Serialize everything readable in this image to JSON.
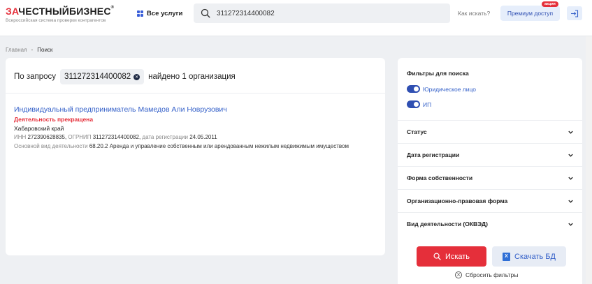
{
  "header": {
    "logo_red": "ЗА",
    "logo_dark": "ЧЕСТНЫЙБИЗНЕС",
    "logo_mark": "®",
    "logo_tagline": "Всероссийская система проверки контрагентов",
    "services_label": "Все услуги",
    "search_value": "311272314400082",
    "howto_label": "Как искать?",
    "premium_label": "Премиум доступ",
    "premium_badge": "акция"
  },
  "breadcrumb": {
    "home": "Главная",
    "separator": "•",
    "current": "Поиск"
  },
  "results": {
    "query_prefix": "По запросу",
    "query_value": "311272314400082",
    "query_suffix": "найдено 1 организация",
    "items": [
      {
        "name": "Индивидуальный предприниматель Мамедов Али Новрузович",
        "status": "Деятельность прекращена",
        "region": "Хабаровский край",
        "inn_label": "ИНН",
        "inn": "272390628835",
        "ogrnip_label": "ОГРНИП",
        "ogrnip": "311272314400082",
        "reg_label": "дата регистрации",
        "reg_date": "24.05.2011",
        "activity_label": "Основной вид деятельности",
        "activity": "68.20.2 Аренда и управление собственным или арендованным нежилым недвижимым имуществом"
      }
    ]
  },
  "filters": {
    "title": "Фильтры для поиска",
    "toggles": [
      {
        "label": "Юридическое лицо",
        "on": true
      },
      {
        "label": "ИП",
        "on": true
      }
    ],
    "sections": [
      "Статус",
      "Дата регистрации",
      "Форма собственности",
      "Организационно-правовая форма",
      "Вид деятельности (ОКВЭД)"
    ],
    "search_button": "Искать",
    "download_button": "Скачать БД",
    "download_icon_letter": "X",
    "reset_label": "Сбросить фильтры"
  },
  "colors": {
    "brand_red": "#e52f3a",
    "link_blue": "#3561c9",
    "accent_blue": "#2f4fb2"
  }
}
